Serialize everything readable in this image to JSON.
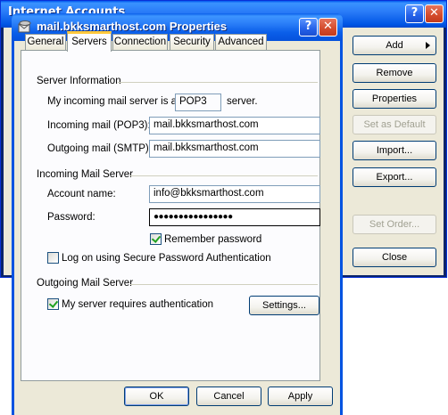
{
  "background_window": {
    "title": "Internet Accounts",
    "buttons": {
      "add": "Add",
      "remove": "Remove",
      "properties": "Properties",
      "set_default": "Set as Default",
      "import": "Import...",
      "export": "Export...",
      "set_order": "Set Order...",
      "close": "Close"
    },
    "help_glyph": "?",
    "close_glyph": "✕"
  },
  "dialog": {
    "title": "mail.bkksmarthost.com Properties",
    "help_glyph": "?",
    "close_glyph": "✕",
    "tabs": [
      "General",
      "Servers",
      "Connection",
      "Security",
      "Advanced"
    ],
    "active_tab": "Servers",
    "server_info": {
      "heading": "Server Information",
      "incoming_type_prefix": "My incoming mail server is a",
      "incoming_type_value": "POP3",
      "incoming_type_suffix": "server.",
      "incoming_label": "Incoming mail (POP3):",
      "incoming_value": "mail.bkksmarthost.com",
      "outgoing_label": "Outgoing mail (SMTP):",
      "outgoing_value": "mail.bkksmarthost.com"
    },
    "incoming_server": {
      "heading": "Incoming Mail Server",
      "account_label": "Account name:",
      "account_value": "info@bkksmarthost.com",
      "password_label": "Password:",
      "password_value": "●●●●●●●●●●●●●●●●",
      "remember_label": "Remember password",
      "remember_checked": true,
      "spa_label": "Log on using Secure Password Authentication",
      "spa_checked": false
    },
    "outgoing_server": {
      "heading": "Outgoing Mail Server",
      "auth_label": "My server requires authentication",
      "auth_checked": true,
      "settings_button": "Settings..."
    },
    "footer": {
      "ok": "OK",
      "cancel": "Cancel",
      "apply": "Apply"
    }
  },
  "colors": {
    "xp_title_blue": "#0058ee",
    "dialog_face": "#ece9d8",
    "button_border": "#003c74",
    "tab_highlight": "#ffc83c"
  }
}
